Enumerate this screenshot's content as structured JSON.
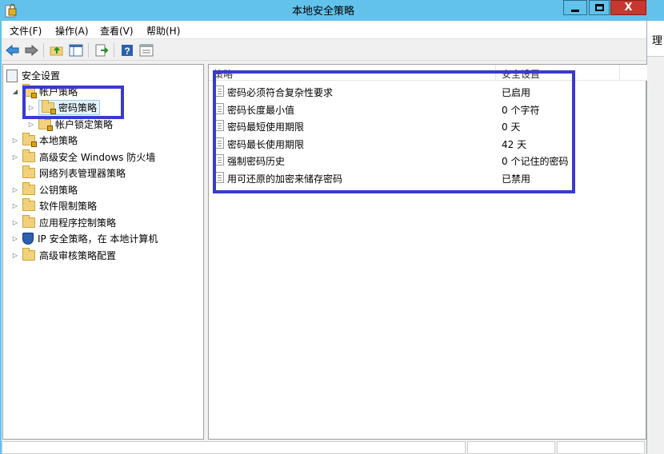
{
  "window": {
    "title": "本地安全策略",
    "close_label": "X"
  },
  "right_strip_text": "理",
  "menu": {
    "items": [
      "文件(F)",
      "操作(A)",
      "查看(V)",
      "帮助(H)"
    ]
  },
  "toolbar": {
    "buttons": [
      "back-icon",
      "forward-icon",
      "up-folder-icon",
      "show-hide-tree-icon",
      "export-list-icon",
      "help-icon",
      "properties-icon"
    ]
  },
  "tree": {
    "root": "安全设置",
    "items": [
      {
        "label": "帐户策略"
      },
      {
        "label": "密码策略"
      },
      {
        "label": "帐户锁定策略"
      },
      {
        "label": "本地策略"
      },
      {
        "label": "高级安全 Windows 防火墙"
      },
      {
        "label": "网络列表管理器策略"
      },
      {
        "label": "公钥策略"
      },
      {
        "label": "软件限制策略"
      },
      {
        "label": "应用程序控制策略"
      },
      {
        "label": "IP 安全策略，在 本地计算机"
      },
      {
        "label": "高级审核策略配置"
      }
    ]
  },
  "list": {
    "columns": [
      "策略",
      "安全设置"
    ],
    "rows": [
      {
        "policy": "密码必须符合复杂性要求",
        "setting": "已启用"
      },
      {
        "policy": "密码长度最小值",
        "setting": "0 个字符"
      },
      {
        "policy": "密码最短使用期限",
        "setting": "0 天"
      },
      {
        "policy": "密码最长使用期限",
        "setting": "42 天"
      },
      {
        "policy": "强制密码历史",
        "setting": "0 个记住的密码"
      },
      {
        "policy": "用可还原的加密来储存密码",
        "setting": "已禁用"
      }
    ]
  },
  "colors": {
    "titlebar": "#62c2eb",
    "highlight_box": "#3a3acf",
    "close_button": "#c7372f"
  }
}
